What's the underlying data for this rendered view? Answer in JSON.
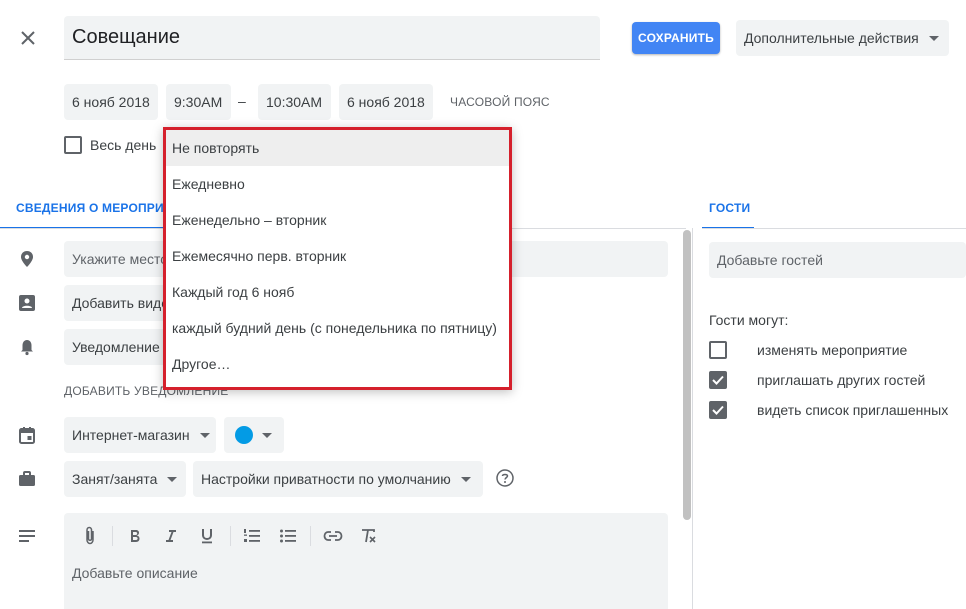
{
  "header": {
    "title": "Совещание",
    "save_label": "СОХРАНИТЬ",
    "more_actions_label": "Дополнительные действия"
  },
  "datetime": {
    "start_date": "6 нояб 2018",
    "start_time": "9:30AM",
    "separator": "–",
    "end_time": "10:30AM",
    "end_date": "6 нояб 2018",
    "timezone_label": "ЧАСОВОЙ ПОЯС",
    "all_day_label": "Весь день"
  },
  "repeat_menu": {
    "items": [
      "Не повторять",
      "Ежедневно",
      "Еженедельно – вторник",
      "Ежемесячно перв. вторник",
      "Каждый год 6 нояб",
      "каждый будний день (с понедельника по пятницу)",
      "Другое…"
    ],
    "selected_index": 0,
    "highlight_color": "#d5202c"
  },
  "tabs": {
    "details": "СВЕДЕНИЯ О МЕРОПРИЯТИИ",
    "guests": "ГОСТИ"
  },
  "details": {
    "location_placeholder": "Укажите место",
    "conference_label": "Добавить видеоконференцию",
    "notification_label": "Уведомление",
    "add_notification_label": "ДОБАВИТЬ УВЕДОМЛЕНИЕ",
    "calendar_label": "Интернет-магазин",
    "event_color": "#039be5",
    "busy_label": "Занят/занята",
    "privacy_label": "Настройки приватности по умолчанию",
    "description_placeholder": "Добавьте описание"
  },
  "guests": {
    "input_placeholder": "Добавьте гостей",
    "permissions_title": "Гости могут:",
    "permissions": [
      {
        "label": "изменять мероприятие",
        "checked": false
      },
      {
        "label": "приглашать других гостей",
        "checked": true
      },
      {
        "label": "видеть список приглашенных",
        "checked": true
      }
    ]
  },
  "colors": {
    "accent": "#1a73e8",
    "save_button": "#4285f4",
    "field_bg": "#f1f3f4"
  }
}
